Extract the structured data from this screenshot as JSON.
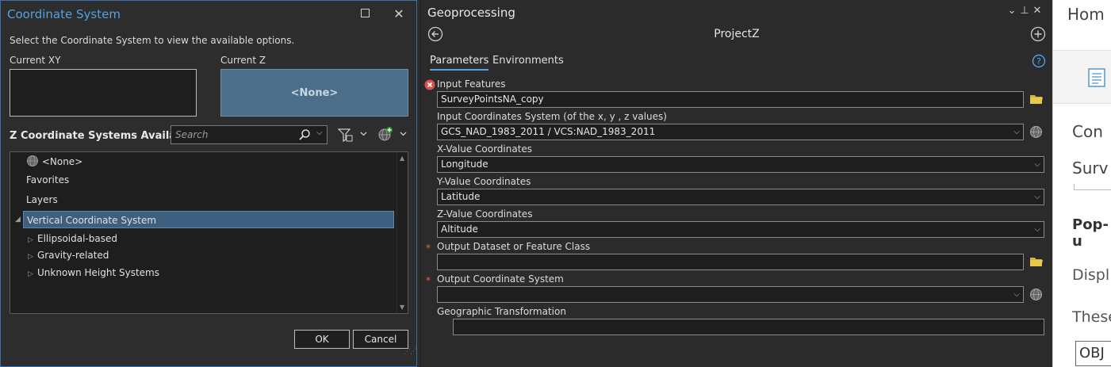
{
  "cs_dialog": {
    "title": "Coordinate System",
    "instruction": "Select the Coordinate System to view the available options.",
    "current_xy_label": "Current XY",
    "current_z_label": "Current Z",
    "current_z_value": "<None>",
    "z_heading": "Z Coordinate Systems Available",
    "search_placeholder": "Search",
    "tree": [
      {
        "label": "<None>",
        "icon": "globe-icon"
      },
      {
        "label": "Favorites"
      },
      {
        "label": "Layers"
      },
      {
        "label": "Vertical Coordinate System",
        "selected": true,
        "expanded": true
      },
      {
        "label": "Ellipsoidal-based"
      },
      {
        "label": "Gravity-related"
      },
      {
        "label": "Unknown Height Systems"
      }
    ],
    "ok_label": "OK",
    "cancel_label": "Cancel"
  },
  "geoprocessing": {
    "title": "Geoprocessing",
    "tool_name": "ProjectZ",
    "tabs": [
      "Parameters",
      "Environments"
    ],
    "params": [
      {
        "label": "Input Features",
        "value": "SurveyPointsNA_copy",
        "error": true
      },
      {
        "label": "Input Coordinates System (of the x, y , z values)",
        "value": "GCS_NAD_1983_2011 / VCS:NAD_1983_2011"
      },
      {
        "label": "X-Value Coordinates",
        "value": "Longitude"
      },
      {
        "label": "Y-Value Coordinates",
        "value": "Latitude"
      },
      {
        "label": "Z-Value Coordinates",
        "value": "Altitude"
      },
      {
        "label": "Output Dataset or Feature Class",
        "value": "",
        "required": true
      },
      {
        "label": "Output Coordinate System",
        "value": "",
        "required": true
      },
      {
        "label": "Geographic Transformation",
        "value": ""
      }
    ],
    "required_mark": "*"
  },
  "right_panel": {
    "home": "Hom",
    "cont": "Con",
    "surv": "Surv",
    "popup": "Pop-u",
    "disp": "Displ",
    "these": "These",
    "obj": "OBJ"
  },
  "colors": {
    "accent": "#4fa3e6",
    "selection": "#3f5f7f",
    "current_z_bg": "#4b6f8a",
    "required": "#e8623b",
    "error": "#d9534f",
    "folder": "#d6b23a"
  }
}
